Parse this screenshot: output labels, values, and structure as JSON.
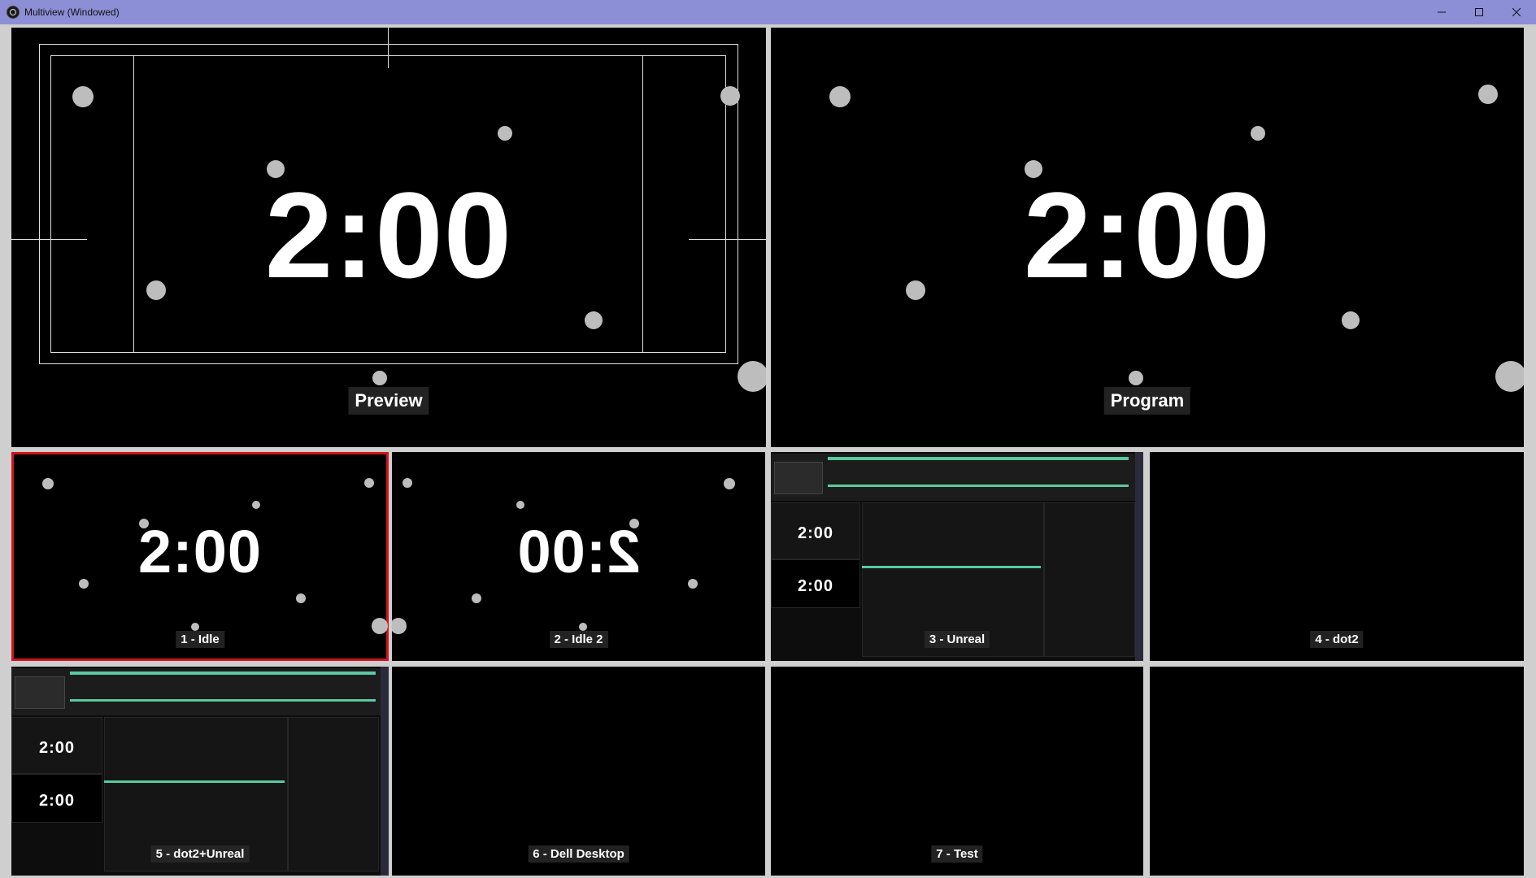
{
  "window": {
    "title": "Multiview (Windowed)",
    "accent": "#8c8ed6"
  },
  "preview": {
    "label": "Preview",
    "clock": "2:00"
  },
  "program": {
    "label": "Program",
    "clock": "2:00"
  },
  "scenes": [
    {
      "label": "1 - Idle",
      "clock": "2:00",
      "selected": true
    },
    {
      "label": "2 - Idle 2",
      "clock": "2:00",
      "mirrored": true
    },
    {
      "label": "3 - Unreal",
      "clock_top": "2:00",
      "clock_bottom": "2:00"
    },
    {
      "label": "4 - dot2"
    },
    {
      "label": "5 - dot2+Unreal",
      "clock_top": "2:00",
      "clock_bottom": "2:00"
    },
    {
      "label": "6 - Dell Desktop"
    },
    {
      "label": "7 - Test"
    },
    {
      "label": ""
    }
  ],
  "colors": {
    "selected_border": "#d0141a",
    "dot": "#bdbdbd",
    "ui_green": "#59c9a1"
  },
  "icons": [
    "obs-icon",
    "minimize-icon",
    "maximize-icon",
    "close-icon"
  ]
}
